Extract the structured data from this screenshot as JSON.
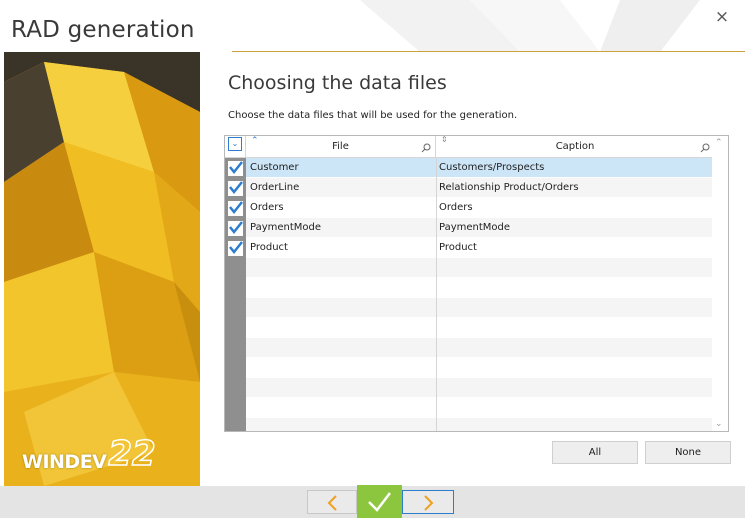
{
  "window": {
    "title": "RAD generation",
    "close_label": "×"
  },
  "branding": {
    "logo_text": "WINDEV",
    "logo_version": "22",
    "accent_color": "#e7b018"
  },
  "main": {
    "heading": "Choosing the data files",
    "subheading": "Choose the data files that will be used for the generation."
  },
  "table": {
    "columns": {
      "file": "File",
      "caption": "Caption"
    },
    "rows": [
      {
        "checked": true,
        "file": "Customer",
        "caption": "Customers/Prospects",
        "selected": true
      },
      {
        "checked": true,
        "file": "OrderLine",
        "caption": "Relationship Product/Orders",
        "selected": false
      },
      {
        "checked": true,
        "file": "Orders",
        "caption": "Orders",
        "selected": false
      },
      {
        "checked": true,
        "file": "PaymentMode",
        "caption": "PaymentMode",
        "selected": false
      },
      {
        "checked": true,
        "file": "Product",
        "caption": "Product",
        "selected": false
      }
    ]
  },
  "buttons": {
    "all_label": "All",
    "none_label": "None"
  },
  "navigation": {
    "prev_icon": "chevron-left-icon",
    "ok_icon": "checkmark-icon",
    "next_icon": "chevron-right-icon",
    "ok_color": "#8cc63f",
    "arrow_color": "#f0a020"
  }
}
